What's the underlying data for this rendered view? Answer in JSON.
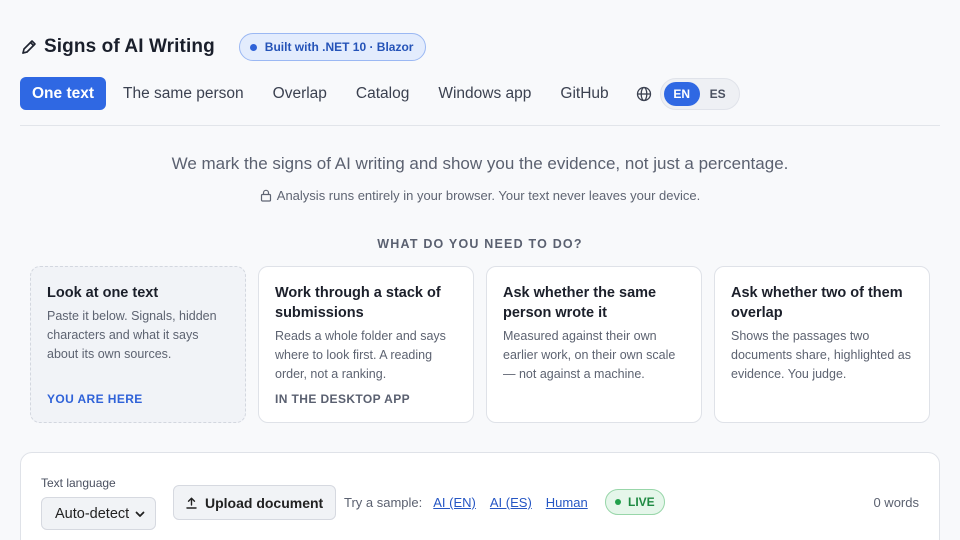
{
  "header": {
    "title": "Signs of AI Writing",
    "badge": "Built with .NET 10 · Blazor"
  },
  "nav": {
    "items": [
      {
        "label": "One text",
        "active": true
      },
      {
        "label": "The same person"
      },
      {
        "label": "Overlap"
      },
      {
        "label": "Catalog"
      },
      {
        "label": "Windows app"
      },
      {
        "label": "GitHub"
      }
    ],
    "languages": [
      {
        "label": "EN",
        "active": true
      },
      {
        "label": "ES"
      }
    ]
  },
  "intro": {
    "tagline": "We mark the signs of AI writing and show you the evidence, not just a percentage.",
    "privacy": "Analysis runs entirely in your browser. Your text never leaves your device.",
    "question": "WHAT DO YOU NEED TO DO?"
  },
  "cards": [
    {
      "title": "Look at one text",
      "body": "Paste it below. Signals, hidden characters and what it says about its own sources.",
      "tag": "YOU ARE HERE",
      "current": true
    },
    {
      "title": "Work through a stack of submissions",
      "body": "Reads a whole folder and says where to look first. A reading order, not a ranking.",
      "tag": "IN THE DESKTOP APP"
    },
    {
      "title": "Ask whether the same person wrote it",
      "body": "Measured against their own earlier work, on their own scale — not against a machine.",
      "tag": ""
    },
    {
      "title": "Ask whether two of them overlap",
      "body": "Shows the passages two documents share, highlighted as evidence. You judge.",
      "tag": ""
    }
  ],
  "toolbar": {
    "language_label": "Text language",
    "language_value": "Auto-detect",
    "upload_label": "Upload document",
    "samples_label": "Try a sample:",
    "samples": [
      "AI (EN)",
      "AI (ES)",
      "Human"
    ],
    "live_label": "LIVE",
    "word_count": "0 words"
  },
  "colors": {
    "accent": "#2f68e3",
    "live_green": "#1f8a43",
    "badge_blue": "#2553b8"
  }
}
